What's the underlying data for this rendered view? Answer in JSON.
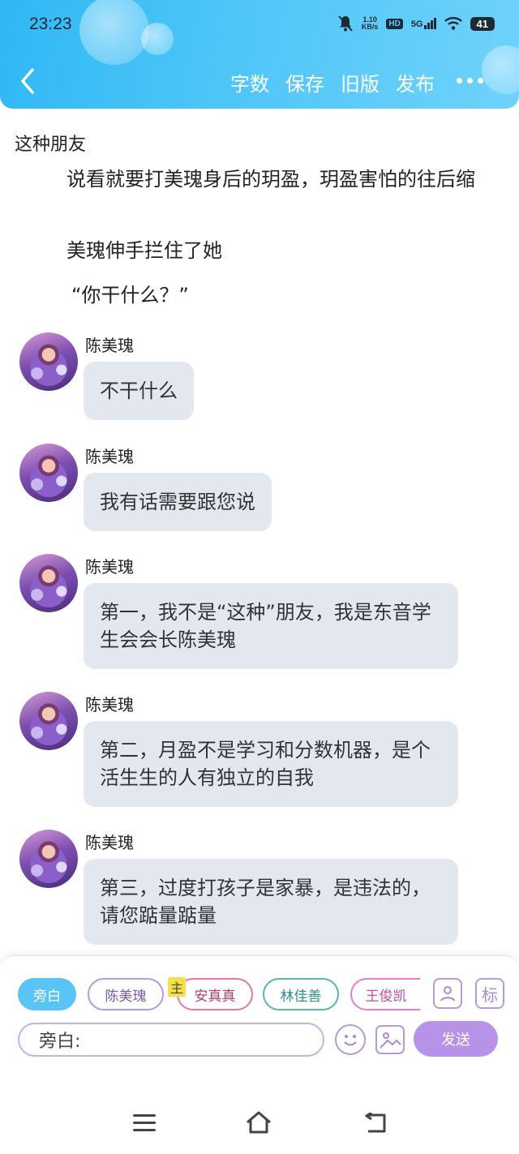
{
  "status_bar": {
    "time": "23:23",
    "speed_value": "1.10",
    "speed_unit": "KB/s",
    "hd": "HD",
    "network": "5G",
    "battery": "41"
  },
  "toolbar": {
    "word_count": "字数",
    "save": "保存",
    "old_version": "旧版",
    "publish": "发布"
  },
  "chapter": {
    "title": "这种朋友"
  },
  "narration": [
    "说看就要打美瑰身后的玥盈，玥盈害怕的往后缩",
    "美瑰伸手拦住了她",
    "“你干什么？”"
  ],
  "messages": [
    {
      "sender": "陈美瑰",
      "text": "不干什么"
    },
    {
      "sender": "陈美瑰",
      "text": "我有话需要跟您说"
    },
    {
      "sender": "陈美瑰",
      "text": "第一，我不是“这种”朋友，我是东音学生会会长陈美瑰"
    },
    {
      "sender": "陈美瑰",
      "text": "第二，月盈不是学习和分数机器，是个活生生的人有独立的自我"
    },
    {
      "sender": "陈美瑰",
      "text": "第三，过度打孩子是家暴，是违法的，请您踮量踮量"
    }
  ],
  "composer": {
    "roles": [
      "旁白",
      "陈美瑰",
      "安真真",
      "林佳善",
      "王俊凯"
    ],
    "main_tag": "主",
    "tag_tool": "标",
    "input_value": "旁白:",
    "send": "发送"
  },
  "colors": {
    "header": "#2fb8f5",
    "bubble": "#e3e8f0",
    "send": "#b692e8",
    "active_role": "#5bc4f7"
  },
  "icons": [
    "back-icon",
    "more-icon",
    "bell-off-icon",
    "wifi-icon",
    "role-manage-icon",
    "emoji-icon",
    "image-icon",
    "menu-icon",
    "home-icon",
    "return-icon"
  ]
}
